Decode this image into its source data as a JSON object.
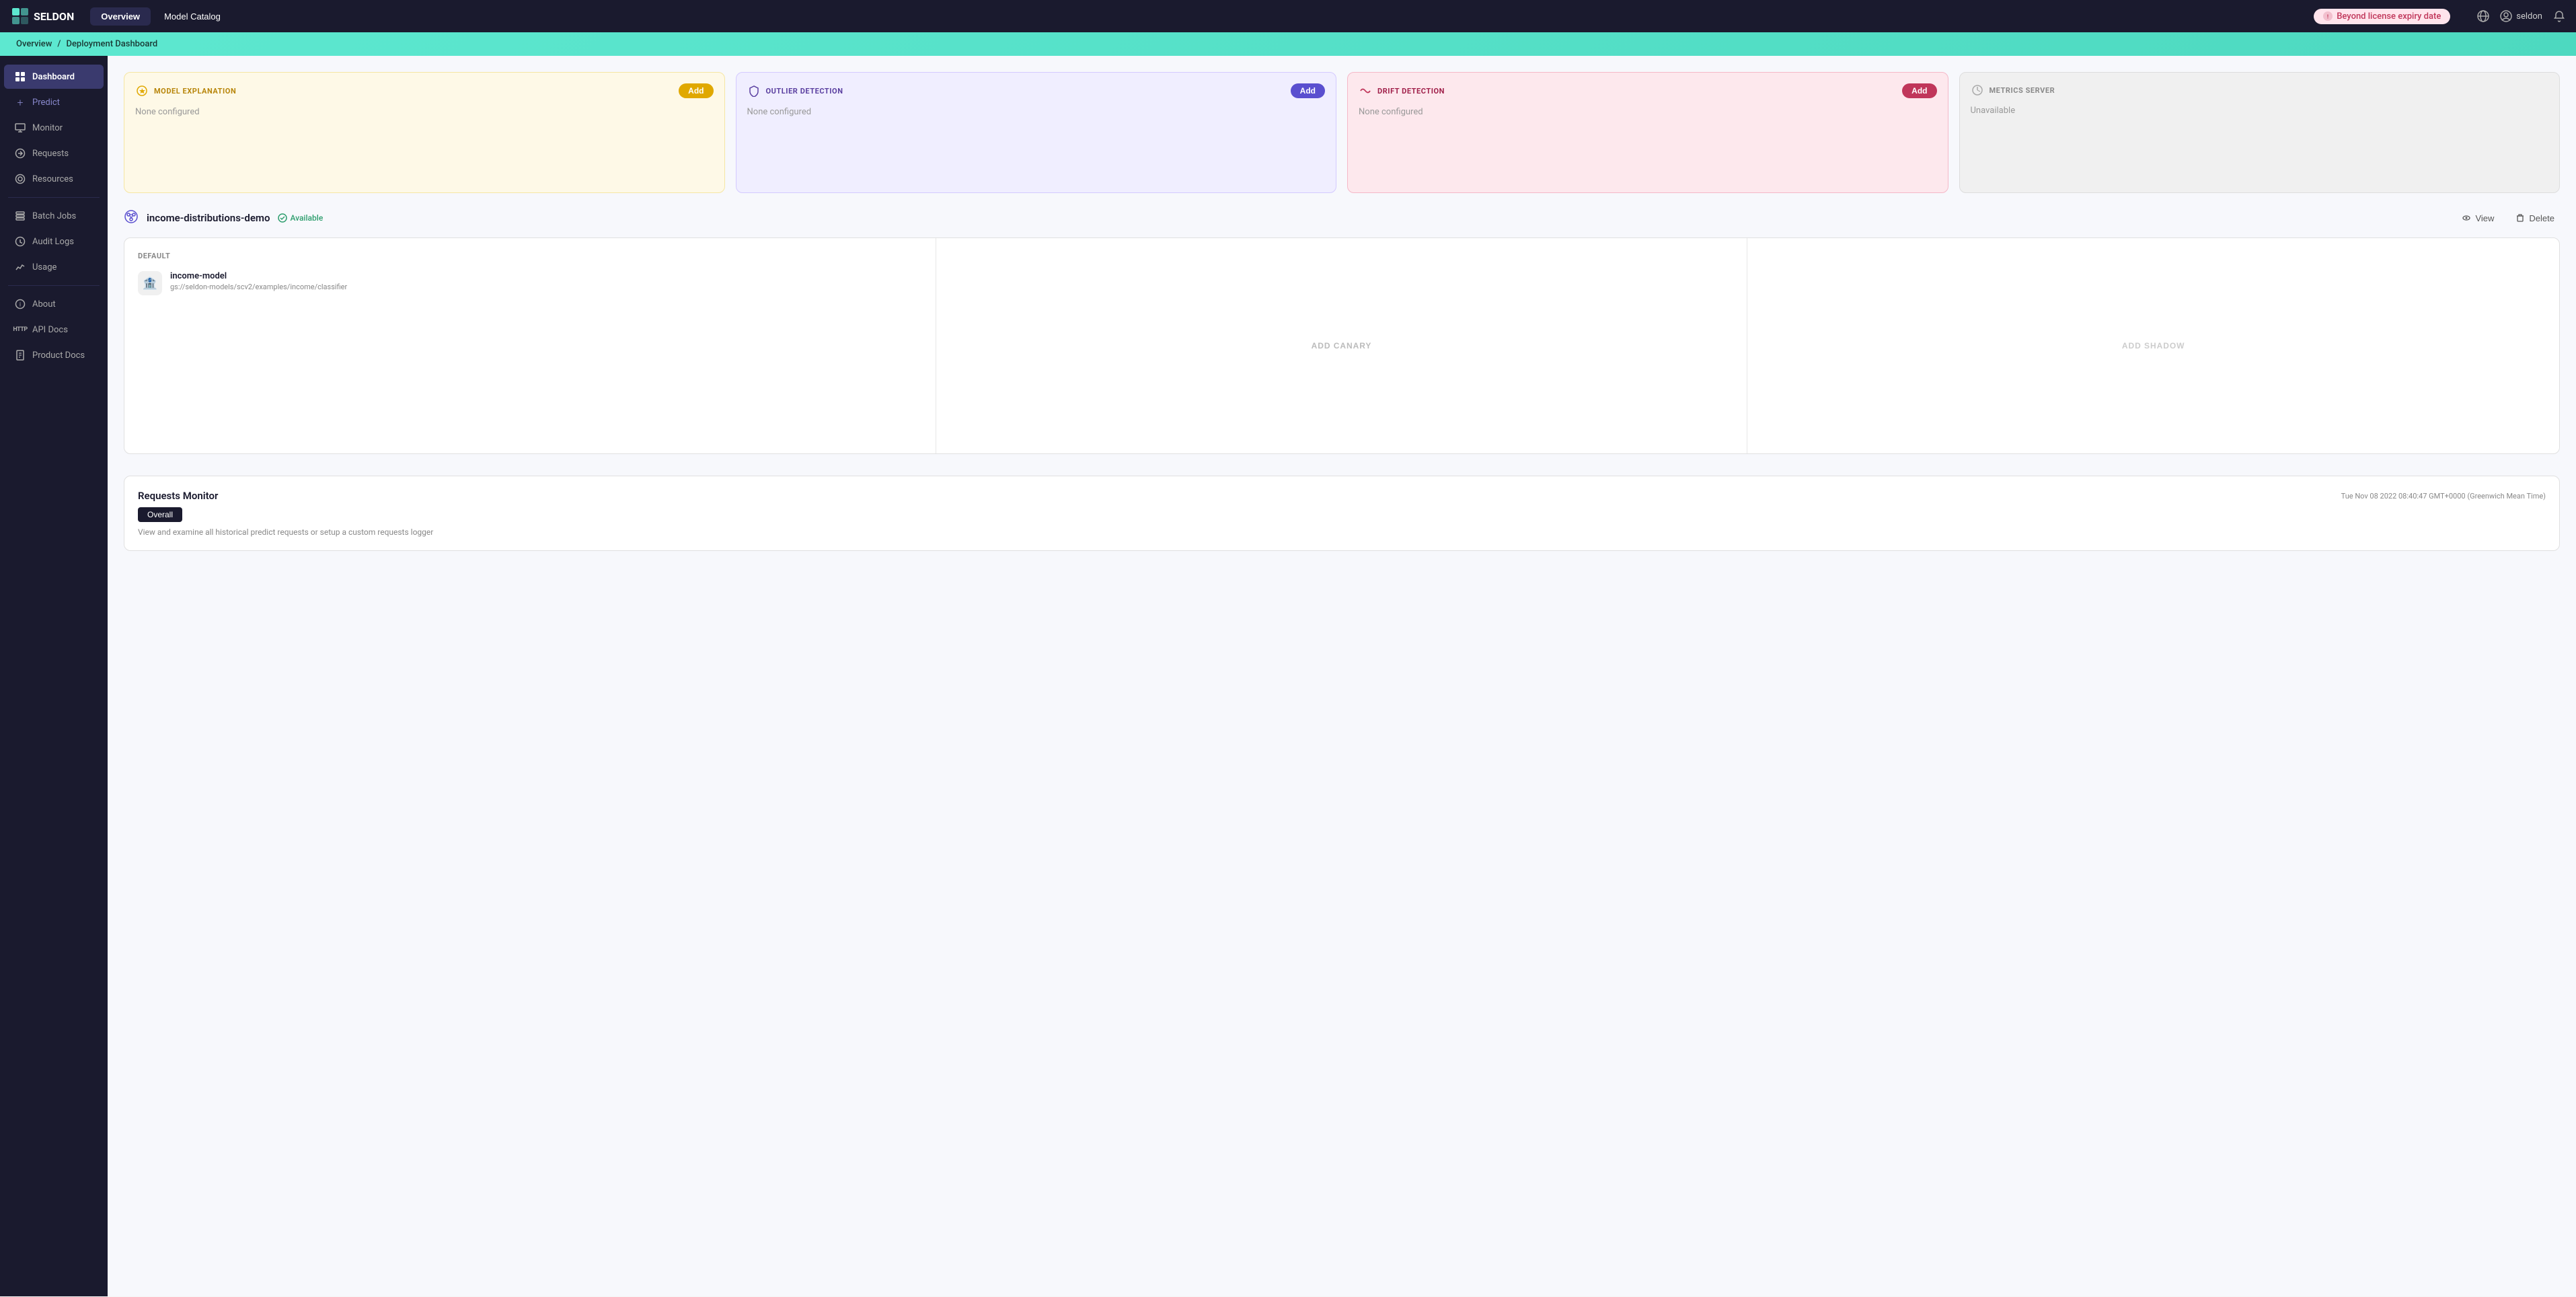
{
  "topNav": {
    "logoText": "SELDON",
    "tabs": [
      {
        "id": "overview",
        "label": "Overview",
        "active": true
      },
      {
        "id": "model-catalog",
        "label": "Model Catalog",
        "active": false
      }
    ],
    "licenseBadge": "Beyond license expiry date",
    "userIcon": "user-icon",
    "notificationIcon": "bell-icon",
    "userName": "seldon"
  },
  "breadcrumb": {
    "items": [
      "Overview",
      "Deployment Dashboard"
    ],
    "separator": "/"
  },
  "sidebar": {
    "items": [
      {
        "id": "dashboard",
        "label": "Dashboard",
        "icon": "grid-icon",
        "active": true
      },
      {
        "id": "predict",
        "label": "Predict",
        "icon": "plus-icon",
        "isAdd": true
      },
      {
        "id": "monitor",
        "label": "Monitor",
        "icon": "monitor-icon"
      },
      {
        "id": "requests",
        "label": "Requests",
        "icon": "requests-icon"
      },
      {
        "id": "resources",
        "label": "Resources",
        "icon": "resources-icon"
      },
      {
        "id": "batch-jobs",
        "label": "Batch Jobs",
        "icon": "batch-icon"
      },
      {
        "id": "audit-logs",
        "label": "Audit Logs",
        "icon": "audit-icon"
      },
      {
        "id": "usage",
        "label": "Usage",
        "icon": "usage-icon"
      },
      {
        "id": "about",
        "label": "About",
        "icon": "about-icon"
      },
      {
        "id": "api-docs",
        "label": "API Docs",
        "icon": "api-icon"
      },
      {
        "id": "product-docs",
        "label": "Product Docs",
        "icon": "docs-icon"
      }
    ]
  },
  "cards": [
    {
      "id": "model-explanation",
      "type": "yellow",
      "title": "MODEL EXPLANATION",
      "iconType": "star-icon",
      "hasAdd": true,
      "addLabel": "Add",
      "addColor": "yellow-btn",
      "content": "None configured"
    },
    {
      "id": "outlier-detection",
      "type": "purple",
      "title": "OUTLIER DETECTION",
      "iconType": "shield-icon",
      "hasAdd": true,
      "addLabel": "Add",
      "addColor": "purple-btn",
      "content": "None configured"
    },
    {
      "id": "drift-detection",
      "type": "pink",
      "title": "DRIFT DETECTION",
      "iconType": "drift-icon",
      "hasAdd": true,
      "addLabel": "Add",
      "addColor": "pink-btn",
      "content": "None configured"
    },
    {
      "id": "metrics-server",
      "type": "gray",
      "title": "METRICS SERVER",
      "iconType": "metrics-icon",
      "hasAdd": false,
      "content": "Unavailable"
    }
  ],
  "deployment": {
    "name": "income-distributions-demo",
    "iconType": "pipeline-icon",
    "status": "Available",
    "actions": [
      {
        "id": "view",
        "label": "View",
        "icon": "eye-icon"
      },
      {
        "id": "delete",
        "label": "Delete",
        "icon": "trash-icon"
      }
    ],
    "pipeline": {
      "default": {
        "title": "Default",
        "model": {
          "name": "income-model",
          "path": "gs://seldon-models/scv2/examples/income/classifier",
          "iconType": "model-emoji"
        }
      },
      "canary": {
        "addLabel": "ADD CANARY"
      },
      "shadow": {
        "addLabel": "ADD SHADOW"
      }
    }
  },
  "requestsMonitor": {
    "title": "Requests Monitor",
    "timestamp": "Tue Nov 08 2022 08:40:47 GMT+0000 (Greenwich Mean Time)",
    "overallLabel": "Overall",
    "description": "View and examine all historical predict requests or setup a custom requests logger"
  }
}
